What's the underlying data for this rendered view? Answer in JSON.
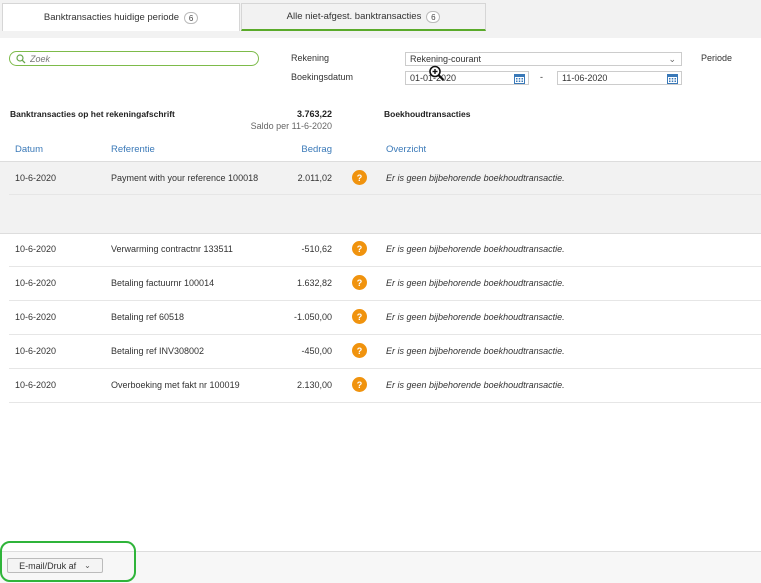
{
  "tabs": [
    {
      "label": "Banktransacties huidige periode",
      "count": "6"
    },
    {
      "label": "Alle niet-afgest. banktransacties",
      "count": "6"
    }
  ],
  "search": {
    "placeholder": "Zoek"
  },
  "filters": {
    "rekening_label": "Rekening",
    "rekening_value": "Rekening-courant",
    "periode_label": "Periode",
    "boekingsdatum_label": "Boekingsdatum",
    "date_from": "01-01-2020",
    "date_separator": "-",
    "date_to": "11-06-2020"
  },
  "summary": {
    "title": "Banktransacties op het rekeningafschrift",
    "amount": "3.763,22",
    "saldo": "Saldo per 11-6-2020",
    "boekhoud_title": "Boekhoudtransacties"
  },
  "columns": {
    "datum": "Datum",
    "referentie": "Referentie",
    "bedrag": "Bedrag",
    "overzicht": "Overzicht"
  },
  "rows": [
    {
      "datum": "10-6-2020",
      "referentie": "Payment with your reference 100018",
      "bedrag": "2.011,02",
      "status": "Er is geen bijbehorende boekhoudtransactie."
    },
    {
      "datum": "10-6-2020",
      "referentie": "Verwarming contractnr 133511",
      "bedrag": "-510,62",
      "status": "Er is geen bijbehorende boekhoudtransactie."
    },
    {
      "datum": "10-6-2020",
      "referentie": "Betaling factuurnr 100014",
      "bedrag": "1.632,82",
      "status": "Er is geen bijbehorende boekhoudtransactie."
    },
    {
      "datum": "10-6-2020",
      "referentie": "Betaling ref 60518",
      "bedrag": "-1.050,00",
      "status": "Er is geen bijbehorende boekhoudtransactie."
    },
    {
      "datum": "10-6-2020",
      "referentie": "Betaling ref INV308002",
      "bedrag": "-450,00",
      "status": "Er is geen bijbehorende boekhoudtransactie."
    },
    {
      "datum": "10-6-2020",
      "referentie": "Overboeking met fakt nr 100019",
      "bedrag": "2.130,00",
      "status": "Er is geen bijbehorende boekhoudtransactie."
    }
  ],
  "question_glyph": "?",
  "footer": {
    "email_label": "E-mail/Druk af"
  },
  "colors": {
    "accent_green": "#5aaa2a",
    "header_blue": "#3a79b8",
    "warning_orange": "#f0930e",
    "highlight_green": "#2fb43a"
  }
}
